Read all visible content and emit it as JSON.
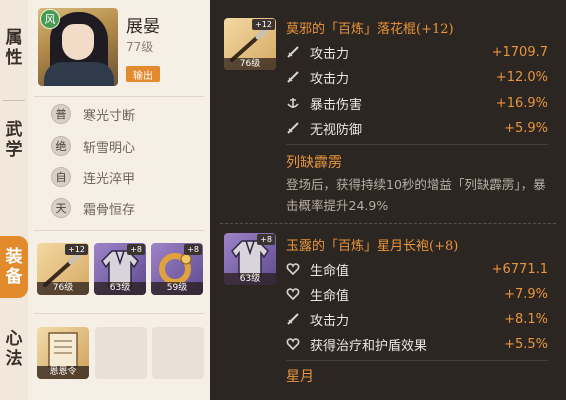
{
  "tabs": [
    {
      "label": "属性",
      "active": false
    },
    {
      "label": "武学",
      "active": false
    },
    {
      "label": "装备",
      "active": true
    },
    {
      "label": "心法",
      "active": false
    }
  ],
  "hero": {
    "element": "风",
    "name": "展晏",
    "level": "77级",
    "role": "输出"
  },
  "skills": [
    {
      "badge": "普",
      "name": "寒光寸断"
    },
    {
      "badge": "绝",
      "name": "斩雪明心"
    },
    {
      "badge": "自",
      "name": "连光淬甲"
    },
    {
      "badge": "天",
      "name": "霜骨恒存"
    }
  ],
  "equipment": [
    {
      "level": "76级",
      "plus": "+12",
      "icon": "spear-icon"
    },
    {
      "level": "63级",
      "plus": "+8",
      "icon": "robe-icon"
    },
    {
      "level": "59级",
      "plus": "+8",
      "icon": "ring-icon"
    }
  ],
  "mind_method": {
    "label": "恩恩令",
    "icon": "scroll-icon"
  },
  "items": [
    {
      "thumb_level": "76级",
      "thumb_plus": "+12",
      "title": "莫邪的「百炼」落花棍(+12)",
      "stats": [
        {
          "icon": "sword-icon",
          "label": "攻击力",
          "value": "+1709.7"
        },
        {
          "icon": "sword-icon",
          "label": "攻击力",
          "value": "+12.0%"
        },
        {
          "icon": "anchor-icon",
          "label": "暴击伤害",
          "value": "+16.9%"
        },
        {
          "icon": "sword-icon",
          "label": "无视防御",
          "value": "+5.9%"
        }
      ],
      "set_name": "列缺霹雳",
      "set_desc": "登场后，获得持续10秒的增益「列缺霹雳」，暴击概率提升24.9%"
    },
    {
      "thumb_level": "63级",
      "thumb_plus": "+8",
      "title": "玉露的「百炼」星月长袍(+8)",
      "stats": [
        {
          "icon": "heart-icon",
          "label": "生命值",
          "value": "+6771.1"
        },
        {
          "icon": "heart-icon",
          "label": "生命值",
          "value": "+7.9%"
        },
        {
          "icon": "sword-icon",
          "label": "攻击力",
          "value": "+8.1%"
        },
        {
          "icon": "heart-icon",
          "label": "获得治疗和护盾效果",
          "value": "+5.5%"
        }
      ],
      "set_name": "星月"
    }
  ]
}
